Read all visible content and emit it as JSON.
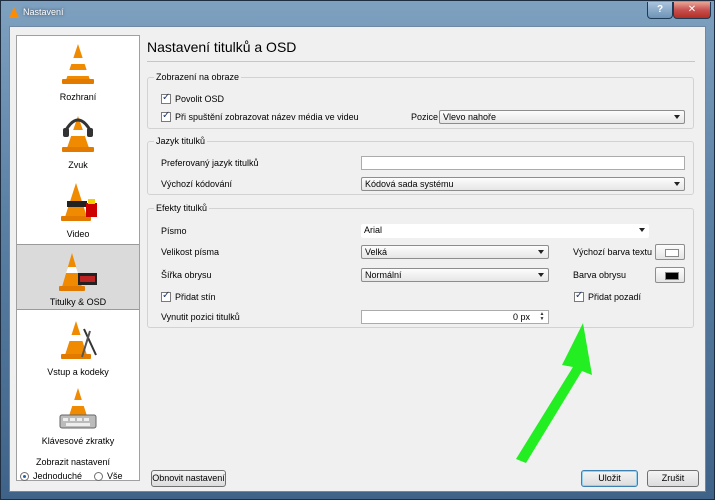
{
  "window": {
    "title": "Nastavení",
    "help": "?",
    "close": "✕"
  },
  "sidebar": {
    "items": [
      {
        "label": "Rozhraní",
        "icon": "cone-icon"
      },
      {
        "label": "Zvuk",
        "icon": "cone-headphones-icon"
      },
      {
        "label": "Video",
        "icon": "cone-glasses-icon"
      },
      {
        "label": "Titulky & OSD",
        "icon": "cone-clock-icon"
      },
      {
        "label": "Vstup a kodeky",
        "icon": "cone-cables-icon"
      },
      {
        "label": "Klávesové zkratky",
        "icon": "cone-keyboard-icon"
      }
    ],
    "selected_index": 3
  },
  "show_settings": {
    "title": "Zobrazit nastavení",
    "simple": "Jednoduché",
    "all": "Vše",
    "selected": "Jednoduché"
  },
  "page": {
    "title": "Nastavení titulků a OSD"
  },
  "display": {
    "group_title": "Zobrazení na obraze",
    "enable_osd": {
      "label": "Povolit OSD",
      "checked": true
    },
    "show_media_title": {
      "label": "Při spuštění zobrazovat název média ve videu",
      "checked": true
    },
    "position_label": "Pozice",
    "position_value": "Vlevo nahoře"
  },
  "language": {
    "group_title": "Jazyk titulků",
    "preferred_label": "Preferovaný jazyk titulků",
    "preferred_value": "",
    "encoding_label": "Výchozí kódování",
    "encoding_value": "Kódová sada systému"
  },
  "effects": {
    "group_title": "Efekty titulků",
    "font_label": "Písmo",
    "font_value": "Arial",
    "size_label": "Velikost písma",
    "size_value": "Velká",
    "outline_width_label": "Šířka obrysu",
    "outline_width_value": "Normální",
    "text_color_label": "Výchozí barva textu",
    "text_color": "#ffffff",
    "outline_color_label": "Barva obrysu",
    "outline_color": "#000000",
    "shadow": {
      "label": "Přidat stín",
      "checked": true
    },
    "background": {
      "label": "Přidat pozadí",
      "checked": true
    },
    "force_position_label": "Vynutit pozici titulků",
    "force_position_value": "0 px"
  },
  "buttons": {
    "reset": "Obnovit nastavení",
    "save": "Uložit",
    "cancel": "Zrušit"
  },
  "annotation": {
    "arrow_color": "#22ee22"
  }
}
